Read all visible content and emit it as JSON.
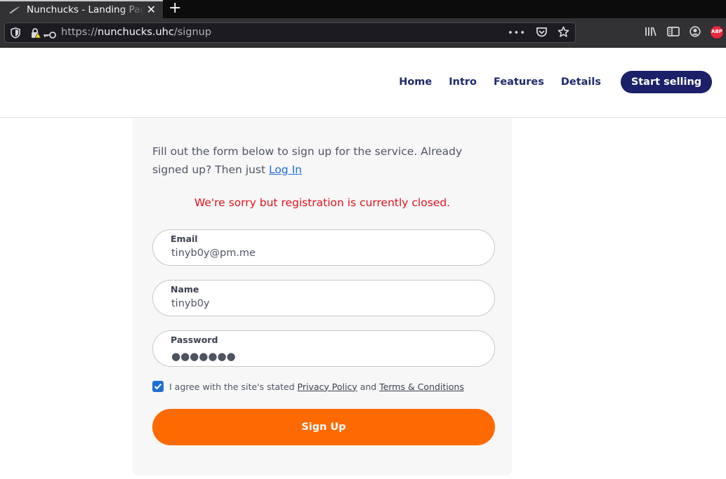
{
  "browser": {
    "tab_title": "Nunchucks - Landing Page",
    "tab_close": "✕",
    "new_tab": "+",
    "url_scheme": "https://",
    "url_host": "nunchucks.uhc",
    "url_path": "/signup",
    "url_more": "•••",
    "extension_badge": "ABP"
  },
  "header": {
    "nav": [
      "Home",
      "Intro",
      "Features",
      "Details"
    ],
    "cta_label": "Start selling"
  },
  "form": {
    "intro_text": "Fill out the form below to sign up for the service. Already signed up? Then just ",
    "login_link": "Log In",
    "error_message": "We're sorry but registration is currently closed.",
    "email_label": "Email",
    "email_value": "tinyb0y@pm.me",
    "name_label": "Name",
    "name_value": "tinyb0y",
    "password_label": "Password",
    "password_mask": "●●●●●●●",
    "agree_checked": true,
    "agree_prefix": "I agree with the site's stated ",
    "privacy_link": "Privacy Policy",
    "agree_and": " and ",
    "terms_link": "Terms & Conditions",
    "submit_label": "Sign Up"
  },
  "colors": {
    "nav_text": "#1f2a6b",
    "cta_bg": "#1b2068",
    "error": "#e0121b",
    "link": "#1f6fd1",
    "submit_bg": "#ff6a00",
    "card_bg": "#f7f7f7"
  },
  "icons": {
    "tab_favicon": "feather-favicon-icon",
    "shield": "tracking-protection-shield-icon",
    "lock": "insecure-lock-icon",
    "key": "key-icon",
    "pocket": "pocket-icon",
    "bookmark": "star-bookmark-icon",
    "library": "library-icon",
    "sidebar": "sidebar-icon",
    "account": "account-icon",
    "adblock": "adblock-plus-icon"
  }
}
